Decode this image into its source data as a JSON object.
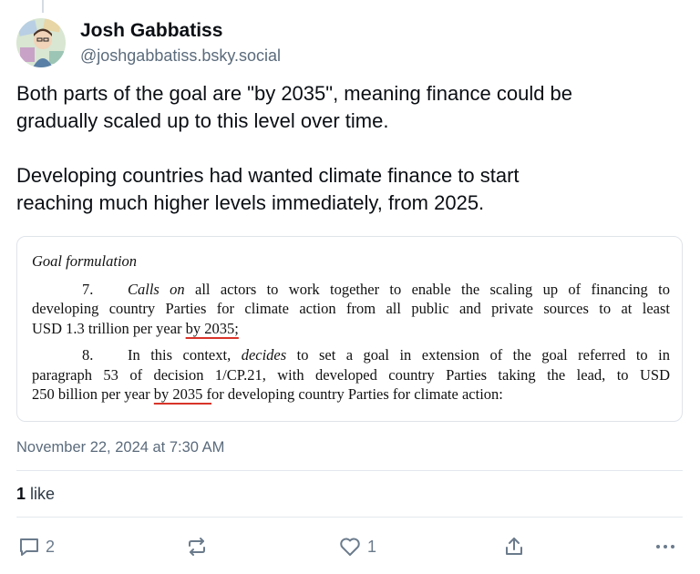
{
  "author": {
    "display_name": "Josh Gabbatiss",
    "handle": "@joshgabbatiss.bsky.social"
  },
  "post": {
    "paragraph1_line1": "Both parts of the goal are \"by 2035\", meaning finance could be",
    "paragraph1_line2": "gradually scaled up to this level over time.",
    "paragraph2_line1": "Developing countries had wanted climate finance to start",
    "paragraph2_line2": "reaching much higher levels immediately, from 2025."
  },
  "embed_document": {
    "heading": "Goal formulation",
    "para7": {
      "number": "7.",
      "verb": "Calls on",
      "line1_rest": " all actors to work together to enable the scaling up of financing to",
      "line2": "developing country Parties for climate action from all public and private sources to at least",
      "line3_pre": "USD 1.3 trillion per year ",
      "line3_underlined": "by 2035;"
    },
    "para8": {
      "number": "8.",
      "line1_pre": "In this context, ",
      "verb": "decides",
      "line1_rest": " to set a goal in extension of the goal referred to in",
      "line2": "paragraph 53 of decision 1/CP.21, with developed country Parties taking the lead, to USD",
      "line3_pre": "250 billion per year ",
      "line3_underlined": "by 2035 f",
      "line3_post": "or developing country Parties for climate action:"
    }
  },
  "meta": {
    "timestamp": "November 22, 2024 at 7:30 AM",
    "like_count": "1",
    "like_label": " like"
  },
  "actions": {
    "reply_count": "2",
    "like_count": "1"
  },
  "colors": {
    "text_primary": "#0b0f14",
    "text_secondary": "#5b6b7c",
    "icon_gray": "#6b7b8c",
    "underline_red": "#d8342a",
    "border": "#dfe4ea"
  },
  "icons": {
    "reply": "speech-bubble-icon",
    "repost": "repost-arrows-icon",
    "like": "heart-outline-icon",
    "share": "share-upload-icon",
    "more": "ellipsis-icon"
  }
}
